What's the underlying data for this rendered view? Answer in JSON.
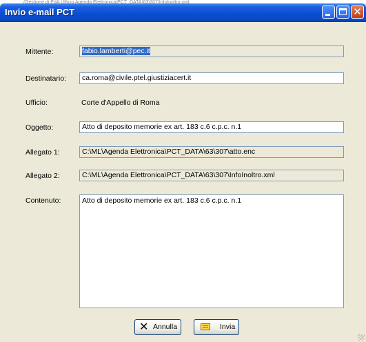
{
  "background": {
    "text": "/Gestione di PdA Ufficio Agenda Elettronica\\PCT_DATA\\63\\307\\Infolnoltro.xml"
  },
  "window": {
    "title": "Invio e-mail PCT",
    "controls": {
      "minimize": "minimize-icon",
      "maximize": "maximize-icon",
      "close": "close-icon"
    }
  },
  "form": {
    "mittente": {
      "label": "Mittente:",
      "value": "fabio.lamberti@pec.it"
    },
    "destinatario": {
      "label": "Destinatario:",
      "value": "ca.roma@civile.ptel.giustiziacert.it"
    },
    "ufficio": {
      "label": "Ufficio:",
      "value": "Corte d'Appello di Roma"
    },
    "oggetto": {
      "label": "Oggetto:",
      "value": "Atto di deposito memorie ex art. 183 c.6 c.p.c. n.1"
    },
    "allegato1": {
      "label": "Allegato 1:",
      "value": "C:\\ML\\Agenda Elettronica\\PCT_DATA\\63\\307\\atto.enc"
    },
    "allegato2": {
      "label": "Allegato 2:",
      "value": "C:\\ML\\Agenda Elettronica\\PCT_DATA\\63\\307\\InfoInoltro.xml"
    },
    "contenuto": {
      "label": "Contenuto:",
      "value": "Atto di deposito memorie ex art. 183 c.6 c.p.c. n.1"
    }
  },
  "buttons": {
    "cancel": {
      "label": "Annulla",
      "icon": "x-icon"
    },
    "send": {
      "label": "Invia",
      "icon": "envelope-icon"
    }
  },
  "colors": {
    "titlebar": "#0a4ed3",
    "window_bg": "#ece9d8",
    "field_border": "#7f9db9",
    "selection": "#316ac5"
  }
}
